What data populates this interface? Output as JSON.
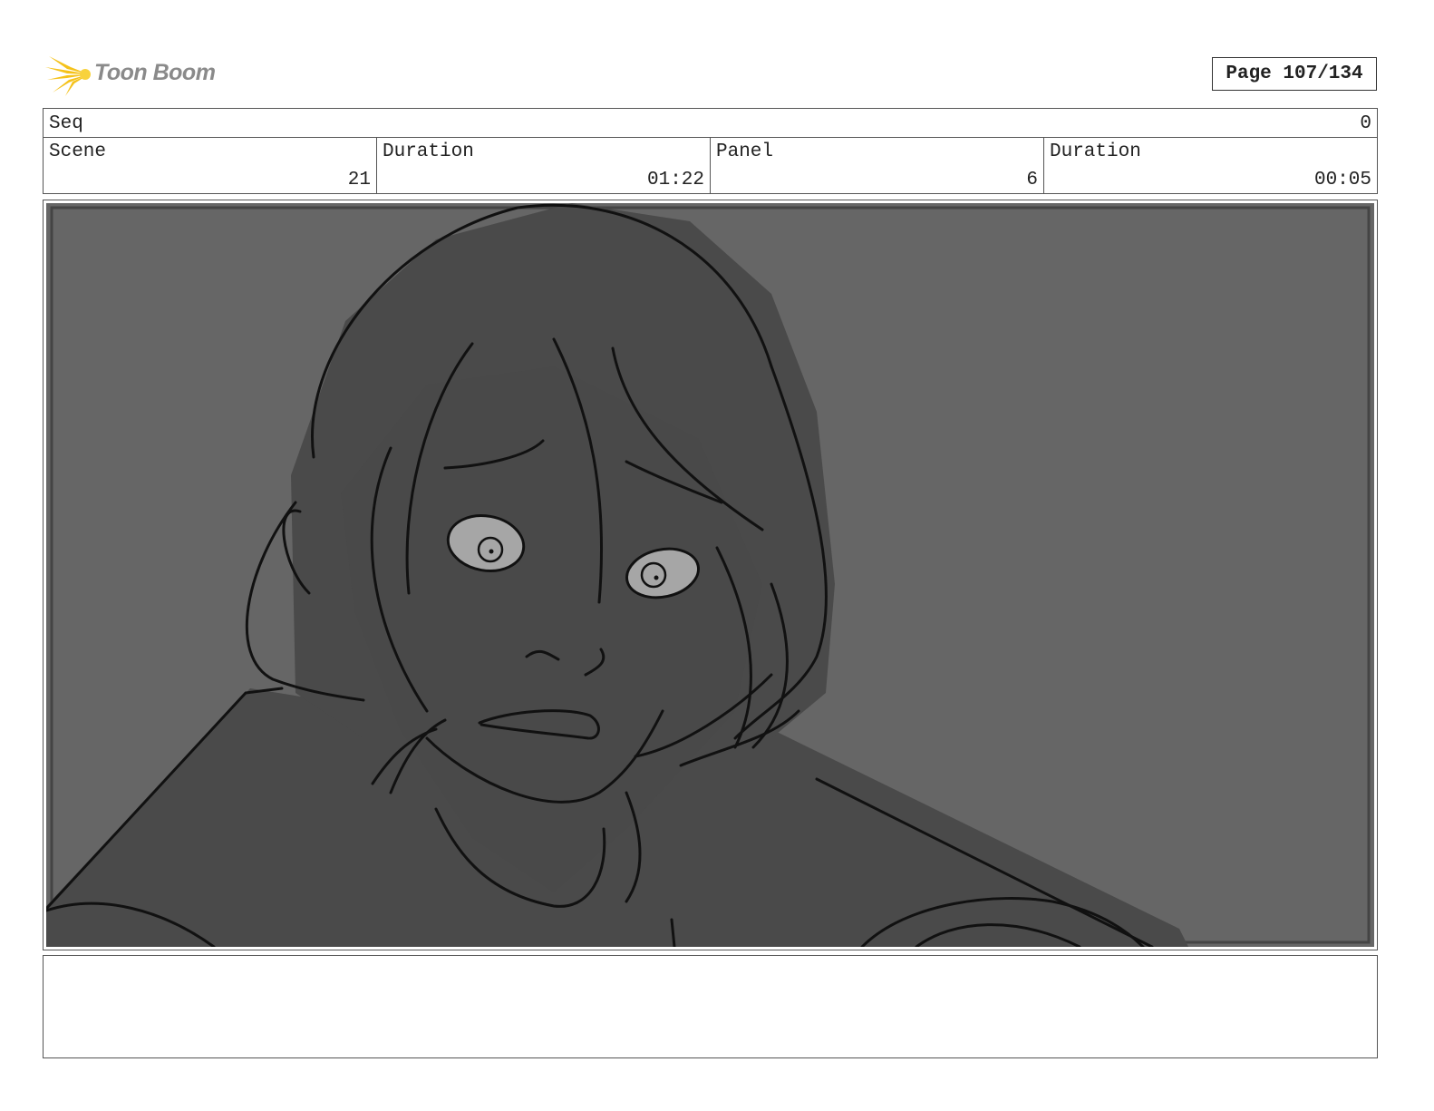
{
  "header": {
    "logo_text": "Toon Boom",
    "page_label": "Page 107/134"
  },
  "info": {
    "seq": {
      "label": "Seq",
      "value": "0"
    },
    "scene": {
      "label": "Scene",
      "value": "21"
    },
    "scene_duration": {
      "label": "Duration",
      "value": "01:22"
    },
    "panel": {
      "label": "Panel",
      "value": "6"
    },
    "panel_duration": {
      "label": "Duration",
      "value": "00:05"
    }
  },
  "colors": {
    "background": "#666666",
    "figure": "#4a4a4a",
    "eye_white": "#a6a6a6",
    "line": "#111111",
    "logo_star": "#f5c21a"
  },
  "notes": {
    "text": ""
  }
}
